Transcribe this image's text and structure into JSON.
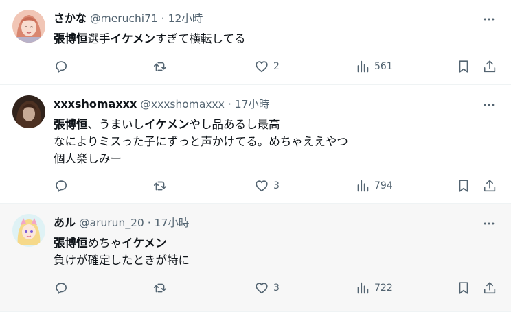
{
  "tweets": [
    {
      "name": "さかな",
      "handle": "@meruchi71",
      "sep": " · ",
      "time": "12小時",
      "lines": [
        [
          {
            "t": "張博恒",
            "b": true
          },
          {
            "t": "選手",
            "b": false
          },
          {
            "t": "イケメン",
            "b": true
          },
          {
            "t": "すぎて横転してる",
            "b": false
          }
        ]
      ],
      "reply_count": "",
      "retweet_count": "",
      "like_count": "2",
      "view_count": "561"
    },
    {
      "name": "xxxshomaxxx",
      "handle": "@xxxshomaxxx",
      "sep": " · ",
      "time": "17小時",
      "lines": [
        [
          {
            "t": "張博恒",
            "b": true
          },
          {
            "t": "、うまいし",
            "b": false
          },
          {
            "t": "イケメン",
            "b": true
          },
          {
            "t": "やし品あるし最高",
            "b": false
          }
        ],
        [
          {
            "t": "なによりミスった子にずっと声かけてる。めちゃええやつ",
            "b": false
          }
        ],
        [
          {
            "t": "個人楽しみー",
            "b": false
          }
        ]
      ],
      "reply_count": "",
      "retweet_count": "",
      "like_count": "3",
      "view_count": "794"
    },
    {
      "name": "あル",
      "handle": "@arurun_20",
      "sep": " · ",
      "time": "17小時",
      "lines": [
        [
          {
            "t": "張博恒",
            "b": true
          },
          {
            "t": "めちゃ",
            "b": false
          },
          {
            "t": "イケメン",
            "b": true
          }
        ],
        [
          {
            "t": "負けが確定したときが特に",
            "b": false
          }
        ]
      ],
      "reply_count": "",
      "retweet_count": "",
      "like_count": "3",
      "view_count": "722"
    }
  ],
  "colors": {
    "text": "#0f1419",
    "secondary": "#536471",
    "divider": "#eff3f4",
    "hover_bg": "#f7f7f7"
  },
  "icons": {
    "more": "more-dots-icon",
    "reply": "reply-bubble-icon",
    "retweet": "retweet-arrows-icon",
    "like": "heart-icon",
    "views": "views-bar-chart-icon",
    "bookmark": "bookmark-icon",
    "share": "share-upload-icon"
  }
}
